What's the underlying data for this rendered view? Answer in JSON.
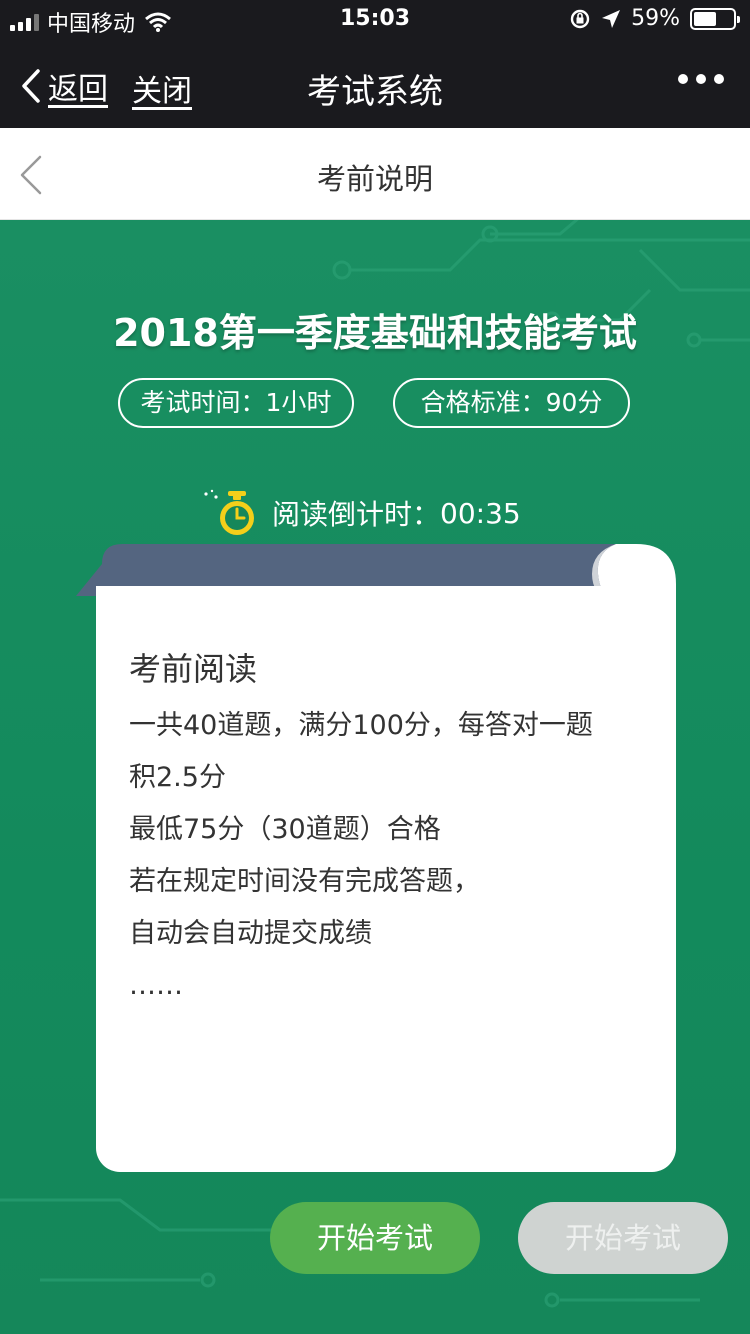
{
  "status_bar": {
    "carrier": "中国移动",
    "time": "15:03",
    "battery_percent": "59%",
    "battery_level": 0.59,
    "icons": [
      "signal-icon",
      "wifi-icon",
      "rotation-lock-icon",
      "location-icon",
      "battery-icon"
    ]
  },
  "nav": {
    "back_label": "返回",
    "close_label": "关闭",
    "title": "考试系统"
  },
  "sub_header": {
    "title": "考前说明"
  },
  "exam": {
    "title": "2018第一季度基础和技能考试",
    "duration": "考试时间：1小时",
    "pass_standard": "合格标准：90分",
    "countdown_label": "阅读倒计时：",
    "countdown_value": "00:35"
  },
  "reading": {
    "title": "考前阅读",
    "lines": [
      "一共40道题，满分100分，每答对一题",
      "积2.5分",
      "最低75分（30道题）合格",
      "若在规定时间没有完成答题，",
      "自动会自动提交成绩",
      "……"
    ]
  },
  "buttons": {
    "start": "开始考试",
    "start_disabled": "开始考试"
  },
  "colors": {
    "background_green": "#15875a",
    "button_green": "#55b04f",
    "disabled_gray": "#cfd3d1",
    "paper_fold": "#546580",
    "dark_bar": "#1a1a1e"
  }
}
